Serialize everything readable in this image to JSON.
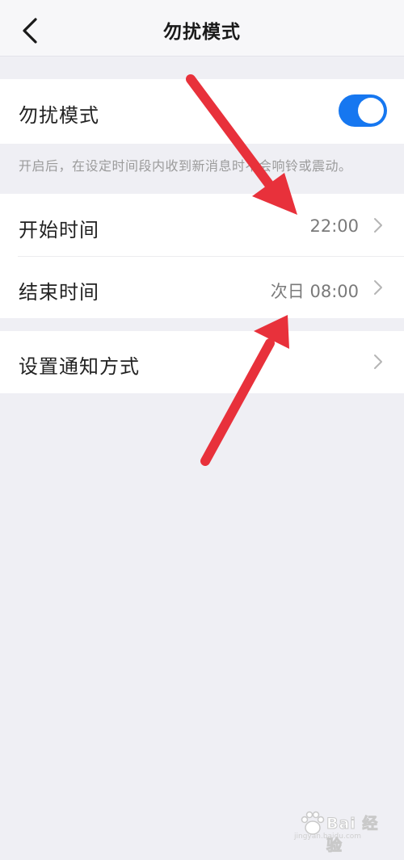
{
  "header": {
    "title": "勿扰模式"
  },
  "dnd": {
    "label": "勿扰模式",
    "enabled": true,
    "hint": "开启后，在设定时间段内收到新消息时不会响铃或震动。"
  },
  "schedule": [
    {
      "label": "开始时间",
      "value": "22:00"
    },
    {
      "label": "结束时间",
      "value": "次日 08:00"
    }
  ],
  "notify": {
    "label": "设置通知方式"
  },
  "colors": {
    "accent": "#1677f0",
    "arrow": "#e8313b",
    "background": "#efeff4"
  },
  "icons": [
    "back-arrow-icon",
    "chevron-right-icon",
    "baidu-paw-icon"
  ],
  "watermark": {
    "text": "Bai 经验",
    "subtext": "jingyan.baidu.com"
  }
}
